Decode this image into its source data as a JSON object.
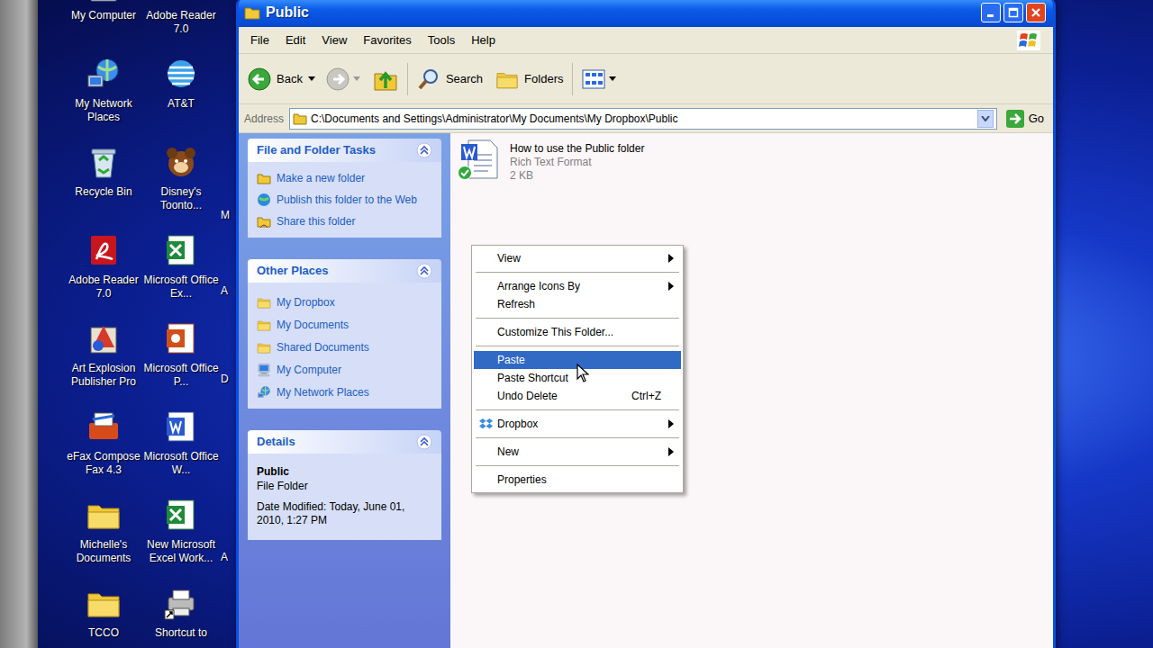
{
  "desktop": {
    "columns": [
      [
        {
          "label": "My Computer"
        },
        {
          "label": "My Network Places"
        },
        {
          "label": "Recycle Bin"
        },
        {
          "label": "Adobe Reader 7.0"
        },
        {
          "label": "Art Explosion Publisher Pro"
        },
        {
          "label": "eFax Compose Fax 4.3"
        },
        {
          "label": "Michelle's Documents"
        },
        {
          "label": "TCCO"
        }
      ],
      [
        {
          "label": "Adobe Reader 7.0"
        },
        {
          "label": "AT&T"
        },
        {
          "label": "Disney's Toonto..."
        },
        {
          "label": "Microsoft Office Ex..."
        },
        {
          "label": "Microsoft Office P..."
        },
        {
          "label": "Microsoft Office W..."
        },
        {
          "label": "New Microsoft Excel Work..."
        },
        {
          "label": "Shortcut to"
        }
      ]
    ],
    "partial_labels": [
      "M",
      "A",
      "D",
      "A"
    ]
  },
  "window": {
    "title": "Public",
    "menu": [
      "File",
      "Edit",
      "View",
      "Favorites",
      "Tools",
      "Help"
    ],
    "toolbar": {
      "back": "Back",
      "search": "Search",
      "folders": "Folders"
    },
    "address": {
      "label": "Address",
      "path": "C:\\Documents and Settings\\Administrator\\My Documents\\My Dropbox\\Public",
      "go": "Go"
    }
  },
  "task_panes": [
    {
      "title": "File and Folder Tasks",
      "expanded": true,
      "items": [
        {
          "label": "Make a new folder"
        },
        {
          "label": "Publish this folder to the Web"
        },
        {
          "label": "Share this folder"
        }
      ]
    },
    {
      "title": "Other Places",
      "expanded": true,
      "items": [
        {
          "label": "My Dropbox"
        },
        {
          "label": "My Documents"
        },
        {
          "label": "Shared Documents"
        },
        {
          "label": "My Computer"
        },
        {
          "label": "My Network Places"
        }
      ]
    }
  ],
  "details": {
    "title": "Details",
    "expanded": true,
    "name": "Public",
    "type": "File Folder",
    "modified": "Date Modified: Today, June 01, 2010, 1:27 PM"
  },
  "files": [
    {
      "name": "How to use the Public folder",
      "type": "Rich Text Format",
      "size": "2 KB",
      "synced": true
    }
  ],
  "context_menu": {
    "items": [
      {
        "kind": "item",
        "label": "View",
        "shortcut": "",
        "submenu": true,
        "icon": false,
        "selected": false
      },
      {
        "kind": "separator"
      },
      {
        "kind": "item",
        "label": "Arrange Icons By",
        "shortcut": "",
        "submenu": true,
        "icon": false,
        "selected": false
      },
      {
        "kind": "item",
        "label": "Refresh",
        "shortcut": "",
        "submenu": false,
        "icon": false,
        "selected": false
      },
      {
        "kind": "separator"
      },
      {
        "kind": "item",
        "label": "Customize This Folder...",
        "shortcut": "",
        "submenu": false,
        "icon": false,
        "selected": false
      },
      {
        "kind": "separator"
      },
      {
        "kind": "item",
        "label": "Paste",
        "shortcut": "",
        "submenu": false,
        "icon": false,
        "selected": true
      },
      {
        "kind": "item",
        "label": "Paste Shortcut",
        "shortcut": "",
        "submenu": false,
        "icon": false,
        "selected": false
      },
      {
        "kind": "item",
        "label": "Undo Delete",
        "shortcut": "Ctrl+Z",
        "submenu": false,
        "icon": false,
        "selected": false
      },
      {
        "kind": "separator"
      },
      {
        "kind": "item",
        "label": "Dropbox",
        "shortcut": "",
        "submenu": true,
        "icon": true,
        "selected": false
      },
      {
        "kind": "separator"
      },
      {
        "kind": "item",
        "label": "New",
        "shortcut": "",
        "submenu": true,
        "icon": false,
        "selected": false
      },
      {
        "kind": "separator"
      },
      {
        "kind": "item",
        "label": "Properties",
        "shortcut": "",
        "submenu": false,
        "icon": false,
        "selected": false
      }
    ]
  }
}
